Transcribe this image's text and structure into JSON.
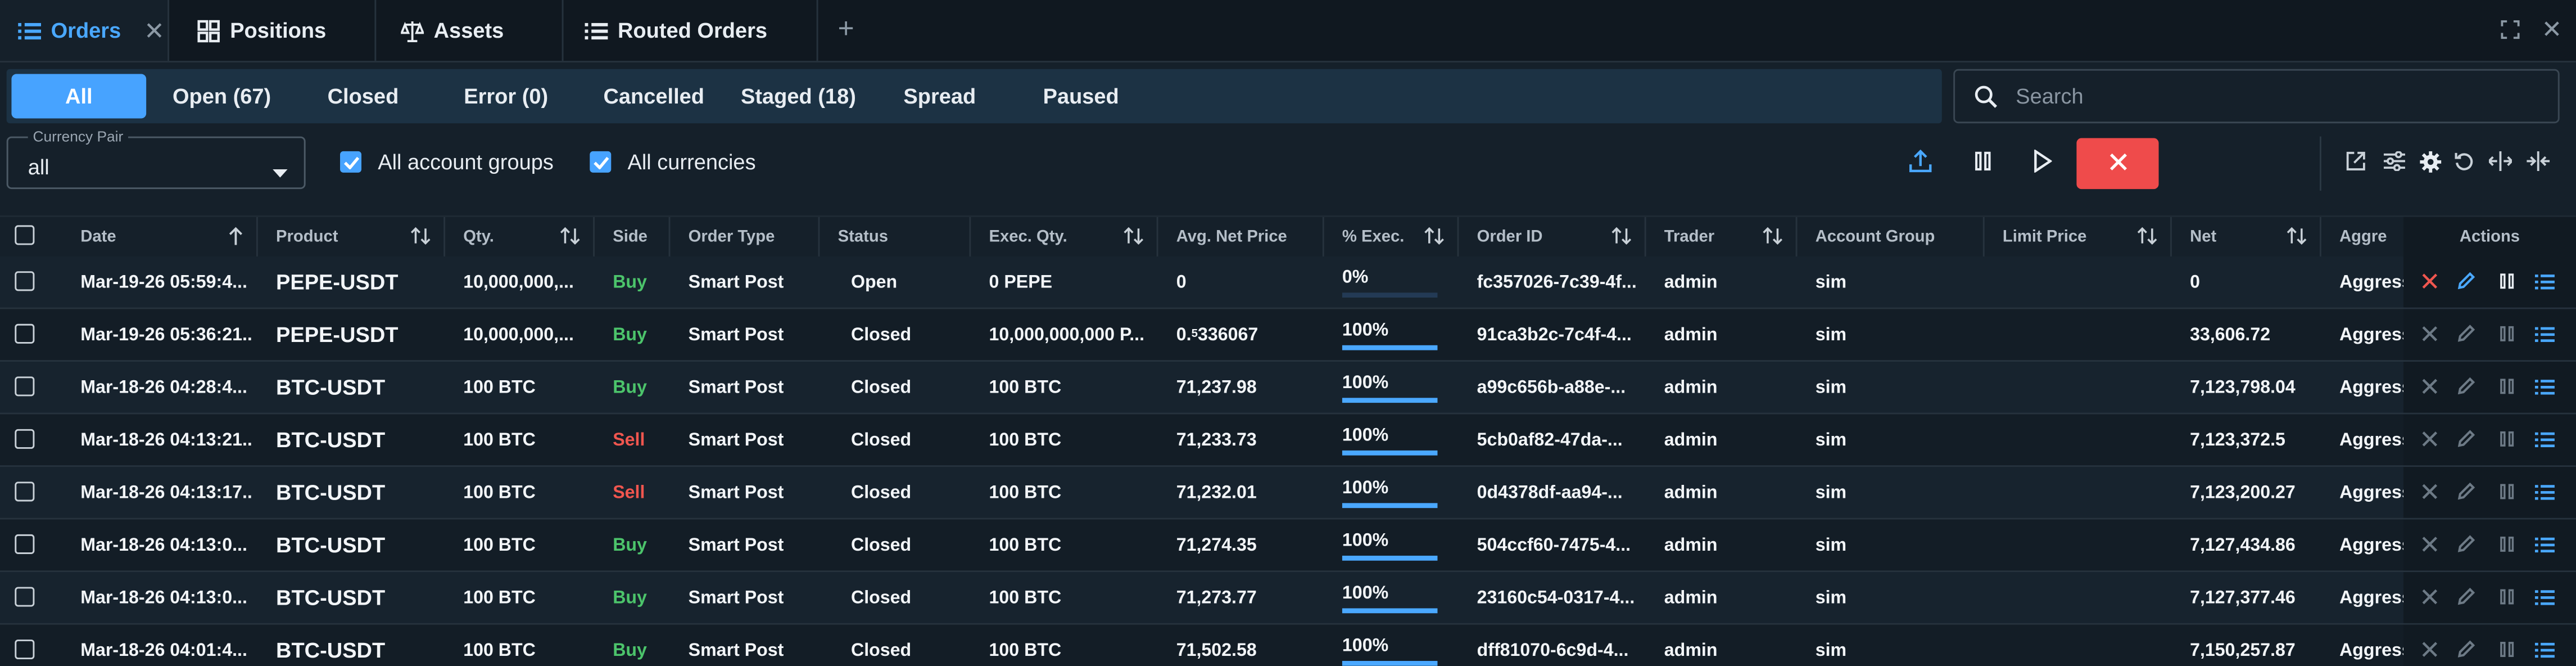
{
  "tabs": [
    {
      "label": "Orders",
      "icon": "list-icon",
      "active": true,
      "closable": true
    },
    {
      "label": "Positions",
      "icon": "grid-icon",
      "active": false
    },
    {
      "label": "Assets",
      "icon": "scale-icon",
      "active": false
    },
    {
      "label": "Routed Orders",
      "icon": "list-icon",
      "active": false
    }
  ],
  "tab_add": "+",
  "filter_tabs": [
    "All",
    "Open (67)",
    "Closed",
    "Error (0)",
    "Cancelled",
    "Staged (18)",
    "Spread",
    "Paused"
  ],
  "active_filter": "All",
  "search": {
    "placeholder": "Search"
  },
  "currency_pair": {
    "label": "Currency Pair",
    "value": "all"
  },
  "checkboxes": {
    "account_groups": "All account groups",
    "currencies": "All currencies"
  },
  "columns": [
    "Date",
    "Product",
    "Qty.",
    "Side",
    "Order Type",
    "Status",
    "Exec. Qty.",
    "Avg. Net Price",
    "% Exec.",
    "Order ID",
    "Trader",
    "Account Group",
    "Limit Price",
    "Net",
    "Aggre",
    "Actions"
  ],
  "rows": [
    {
      "date": "Mar-19-26 05:59:4...",
      "product": "PEPE-USDT",
      "qty": "10,000,000,...",
      "side": "Buy",
      "order_type": "Smart Post",
      "status": "Open",
      "exec_qty": "0 PEPE",
      "avg_price": "0",
      "exec_label": "0%",
      "exec_pct": 0,
      "order_id": "fc357026-7c39-4f...",
      "trader": "admin",
      "account_group": "sim",
      "net": "0",
      "aggr": "Aggress"
    },
    {
      "date": "Mar-19-26 05:36:21...",
      "product": "PEPE-USDT",
      "qty": "10,000,000,...",
      "side": "Buy",
      "order_type": "Smart Post",
      "status": "Closed",
      "exec_qty": "10,000,000,000 P...",
      "avg_price_prefix": "0.",
      "avg_price_sub": "5",
      "avg_price_suffix": "336067",
      "exec_label": "100%",
      "exec_pct": 100,
      "order_id": "91ca3b2c-7c4f-4...",
      "trader": "admin",
      "account_group": "sim",
      "net": "33,606.72",
      "aggr": "Aggress"
    },
    {
      "date": "Mar-18-26 04:28:4...",
      "product": "BTC-USDT",
      "qty": "100 BTC",
      "side": "Buy",
      "order_type": "Smart Post",
      "status": "Closed",
      "exec_qty": "100 BTC",
      "avg_price": "71,237.98",
      "exec_label": "100%",
      "exec_pct": 100,
      "order_id": "a99c656b-a88e-...",
      "trader": "admin",
      "account_group": "sim",
      "net": "7,123,798.04",
      "aggr": "Aggress"
    },
    {
      "date": "Mar-18-26 04:13:21...",
      "product": "BTC-USDT",
      "qty": "100 BTC",
      "side": "Sell",
      "order_type": "Smart Post",
      "status": "Closed",
      "exec_qty": "100 BTC",
      "avg_price": "71,233.73",
      "exec_label": "100%",
      "exec_pct": 100,
      "order_id": "5cb0af82-47da-...",
      "trader": "admin",
      "account_group": "sim",
      "net": "7,123,372.5",
      "aggr": "Aggress"
    },
    {
      "date": "Mar-18-26 04:13:17...",
      "product": "BTC-USDT",
      "qty": "100 BTC",
      "side": "Sell",
      "order_type": "Smart Post",
      "status": "Closed",
      "exec_qty": "100 BTC",
      "avg_price": "71,232.01",
      "exec_label": "100%",
      "exec_pct": 100,
      "order_id": "0d4378df-aa94-...",
      "trader": "admin",
      "account_group": "sim",
      "net": "7,123,200.27",
      "aggr": "Aggress"
    },
    {
      "date": "Mar-18-26 04:13:0...",
      "product": "BTC-USDT",
      "qty": "100 BTC",
      "side": "Buy",
      "order_type": "Smart Post",
      "status": "Closed",
      "exec_qty": "100 BTC",
      "avg_price": "71,274.35",
      "exec_label": "100%",
      "exec_pct": 100,
      "order_id": "504ccf60-7475-4...",
      "trader": "admin",
      "account_group": "sim",
      "net": "7,127,434.86",
      "aggr": "Aggress"
    },
    {
      "date": "Mar-18-26 04:13:0...",
      "product": "BTC-USDT",
      "qty": "100 BTC",
      "side": "Buy",
      "order_type": "Smart Post",
      "status": "Closed",
      "exec_qty": "100 BTC",
      "avg_price": "71,273.77",
      "exec_label": "100%",
      "exec_pct": 100,
      "order_id": "23160c54-0317-4...",
      "trader": "admin",
      "account_group": "sim",
      "net": "7,127,377.46",
      "aggr": "Aggress"
    },
    {
      "date": "Mar-18-26 04:01:4...",
      "product": "BTC-USDT",
      "qty": "100 BTC",
      "side": "Buy",
      "order_type": "Smart Post",
      "status": "Closed",
      "exec_qty": "100 BTC",
      "avg_price": "71,502.58",
      "exec_label": "100%",
      "exec_pct": 100,
      "order_id": "dff81070-6c9d-4...",
      "trader": "admin",
      "account_group": "sim",
      "net": "7,150,257.87",
      "aggr": "Aggress"
    }
  ],
  "colors": {
    "accent": "#47a3ff",
    "buy": "#4cc46b",
    "sell": "#f0564f",
    "danger": "#ef4b4b",
    "background": "#15202a"
  }
}
